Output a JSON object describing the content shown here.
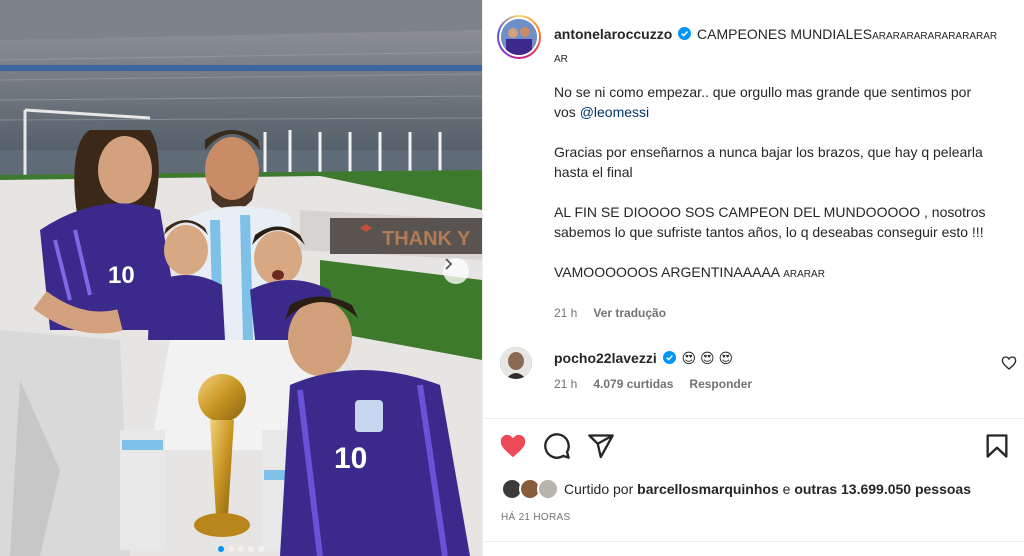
{
  "post": {
    "author": "antonelaroccuzzo",
    "caption_title": "CAMPEONES MUNDIALES",
    "caption_title_small_1": "ARARARARARARARARAR",
    "caption_title_small_2": "AR",
    "caption_paragraphs": [
      {
        "text": "No se ni como empezar.. que orgullo mas grande que sentimos por vos ",
        "mention": "@leomessi"
      },
      {
        "text": "Gracias por enseñarnos a nunca bajar los brazos, que hay q pelearla hasta el final"
      },
      {
        "text": "AL FIN SE DIOOOO SOS CAMPEON DEL MUNDOOOOO , nosotros sabemos lo que sufriste tantos años, lo q deseabas conseguir esto !!!"
      },
      {
        "text": "VAMOOOOOOS ARGENTINAAAAA ",
        "small": "ARARAR"
      }
    ],
    "caption_time": "21 h",
    "see_translation": "Ver tradução"
  },
  "comment": {
    "username": "pocho22lavezzi",
    "emojis": "😍 😍 😍",
    "time": "21 h",
    "likes": "4.079 curtidas",
    "reply": "Responder"
  },
  "likes_line": {
    "prefix": "Curtido por ",
    "first_user": "barcellosmarquinhos",
    "middle": " e ",
    "others": "outras 13.699.050 pessoas"
  },
  "posted_ago": "HÁ 21 HORAS",
  "photo": {
    "banner_text": "THANK Y",
    "jersey_number": "10"
  },
  "carousel": {
    "count": 5,
    "active": 0
  },
  "colors": {
    "like_red": "#ed4956",
    "verified_blue": "#0095f6",
    "mention_blue": "#00376b",
    "muted_gray": "#737373",
    "jersey_purple": "#3b2a8c"
  },
  "icons": [
    "verified-icon",
    "heart-filled-icon",
    "comment-icon",
    "share-icon",
    "bookmark-icon",
    "heart-outline-icon",
    "chevron-right-icon"
  ]
}
